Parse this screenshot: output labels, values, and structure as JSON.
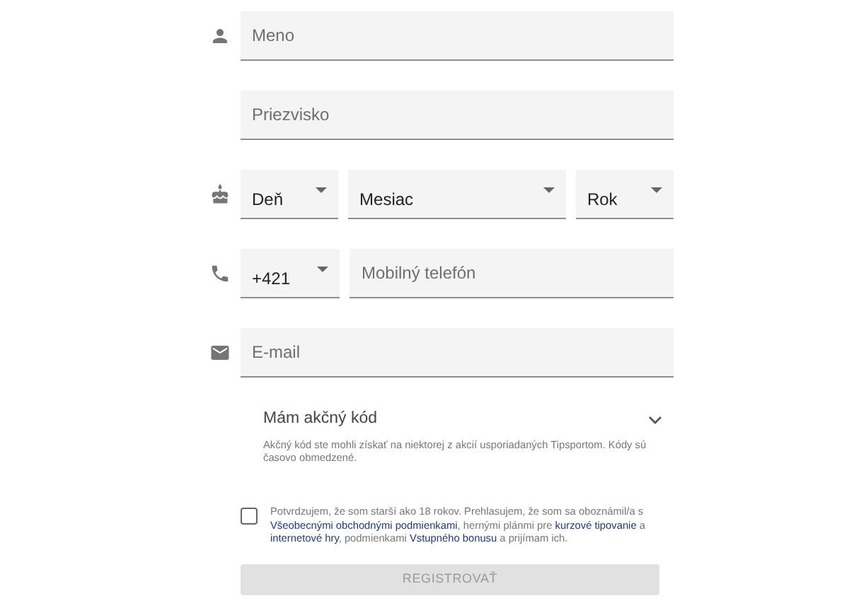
{
  "rows": [
    {
      "fields": [
        {
          "kind": "input",
          "placeholder": "Meno"
        }
      ]
    },
    {
      "fields": [
        {
          "kind": "input",
          "placeholder": "Priezvisko"
        }
      ]
    },
    {
      "fields": [
        {
          "kind": "select",
          "value": "Deň"
        },
        {
          "kind": "select",
          "value": "Mesiac"
        },
        {
          "kind": "select",
          "value": "Rok"
        }
      ]
    },
    {
      "fields": [
        {
          "kind": "select",
          "value": "+421"
        },
        {
          "kind": "input",
          "placeholder": "Mobilný telefón"
        }
      ]
    },
    {
      "fields": [
        {
          "kind": "input",
          "placeholder": "E-mail"
        }
      ]
    }
  ],
  "promo": {
    "label": "Mám akčný kód",
    "expanded": false,
    "help": "Akčný kód ste mohli získať na niektorej z akcií usporiadaných Tipsportom. Kódy sú časovo obmedzené."
  },
  "consent": {
    "checked": false,
    "parts": [
      {
        "text": "Potvrdzujem, že som starší ako 18 rokov. Prehlasujem, že som sa oboznámil/a s ",
        "link": false
      },
      {
        "text": "Všeobecnými obchodnými podmienkami",
        "link": true
      },
      {
        "text": ", hernými plánmi pre ",
        "link": false
      },
      {
        "text": "kurzové tipovanie",
        "link": true
      },
      {
        "text": " a ",
        "link": false
      },
      {
        "text": "internetové hry",
        "link": true
      },
      {
        "text": ", podmienkami ",
        "link": false
      },
      {
        "text": "Vstupného bonusu",
        "link": true
      },
      {
        "text": " a prijímam ich.",
        "link": false
      }
    ]
  },
  "submit": {
    "label": "REGISTROVAŤ",
    "disabled": true
  }
}
